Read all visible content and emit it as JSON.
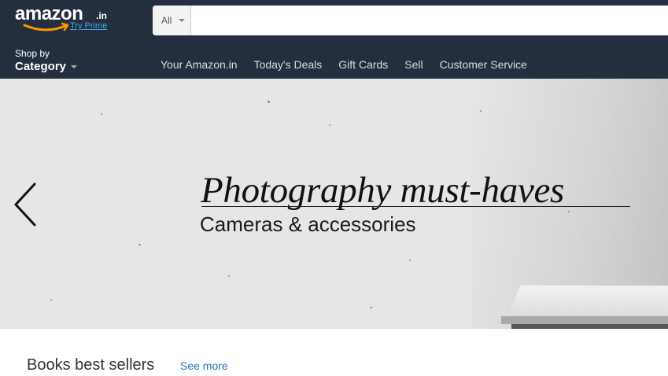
{
  "header": {
    "logo": {
      "wordmark": "amazon",
      "tld": ".in",
      "prime_link": "Try Prime"
    },
    "search": {
      "department": "All",
      "placeholder": "",
      "value": ""
    },
    "shop_by": {
      "line1": "Shop by",
      "line2": "Category"
    },
    "nav_links": [
      "Your Amazon.in",
      "Today's Deals",
      "Gift Cards",
      "Sell",
      "Customer Service"
    ]
  },
  "hero": {
    "title": "Photography must-haves",
    "subtitle": "Cameras & accessories",
    "prev_icon": "chevron-left-icon"
  },
  "books_section": {
    "title": "Books best sellers",
    "see_more": "See more"
  },
  "colors": {
    "header_bg": "#232f3e",
    "accent_orange": "#ff9900",
    "prime_link": "#3ea6d8",
    "link_blue": "#2a6fb0",
    "hero_bg": "#e6e6e4"
  }
}
